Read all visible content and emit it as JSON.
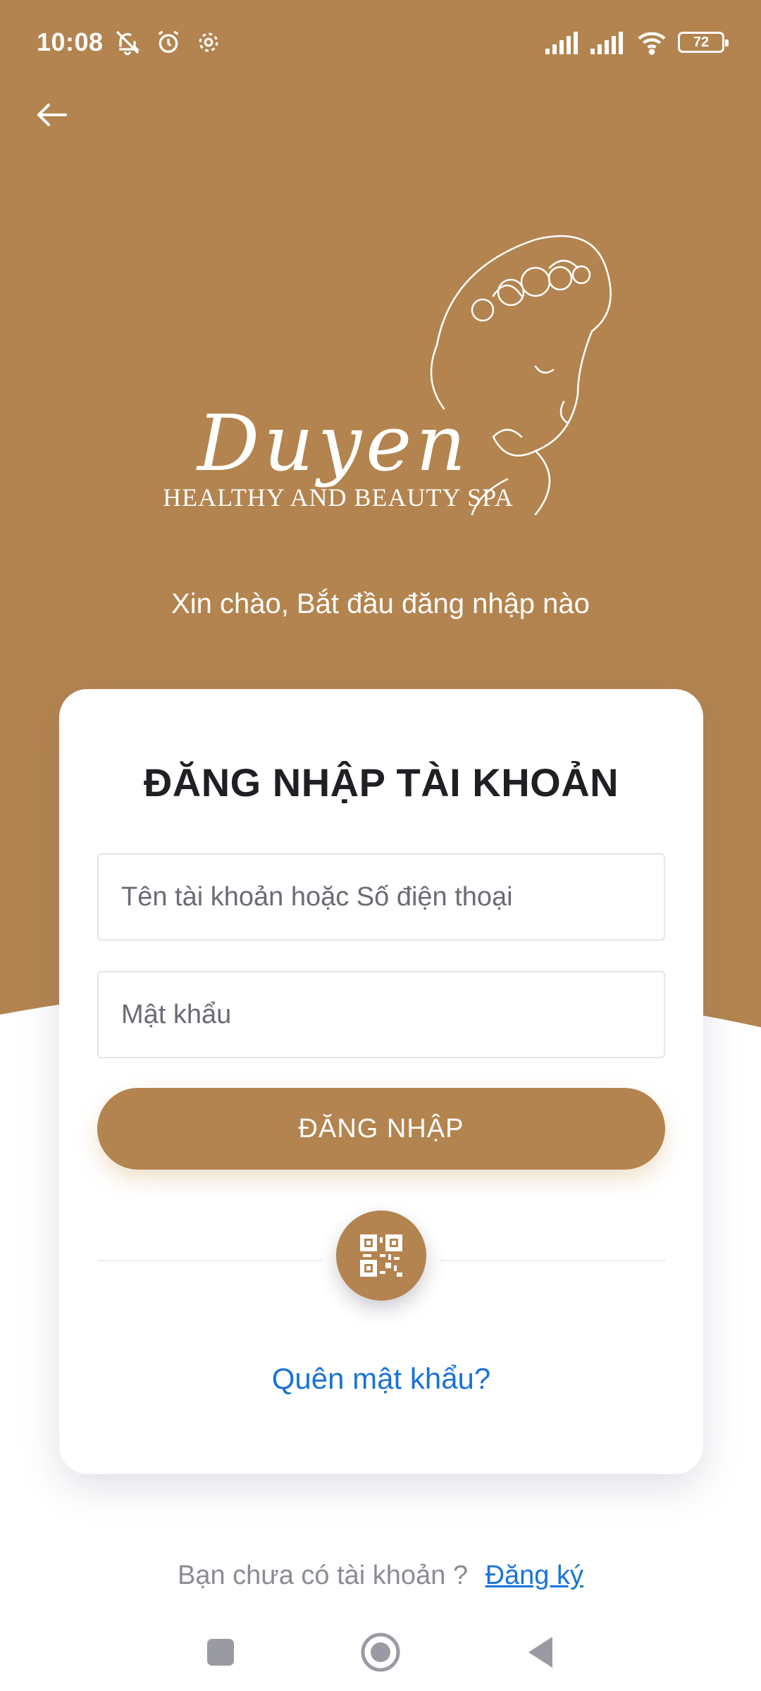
{
  "status_bar": {
    "time": "10:08",
    "icons_left": [
      "mute-icon",
      "alarm-icon",
      "settings-gear-icon"
    ],
    "icons_right": [
      "signal-icon",
      "signal-icon",
      "wifi-icon"
    ],
    "battery": "72"
  },
  "header": {
    "back_icon": "back-arrow-icon",
    "logo_script": "Duyen",
    "logo_subtitle": "HEALTHY AND BEAUTY SPA",
    "greeting": "Xin chào, Bắt đầu đăng nhập nào"
  },
  "login_card": {
    "title": "ĐĂNG NHẬP TÀI KHOẢN",
    "username_placeholder": "Tên tài khoản hoặc Số điện thoại",
    "password_placeholder": "Mật khẩu",
    "login_button": "ĐĂNG NHẬP",
    "qr_icon": "qr-code-icon",
    "forgot_password": "Quên mật khẩu?"
  },
  "footer": {
    "no_account_text": "Bạn chưa có tài khoản ?",
    "signup_link": "Đăng ký"
  },
  "nav_bar": {
    "buttons": [
      "recent-apps-icon",
      "home-icon",
      "back-icon"
    ]
  },
  "colors": {
    "brand": "#b3844f",
    "link": "#1a73d6",
    "title": "#1f1f24"
  }
}
